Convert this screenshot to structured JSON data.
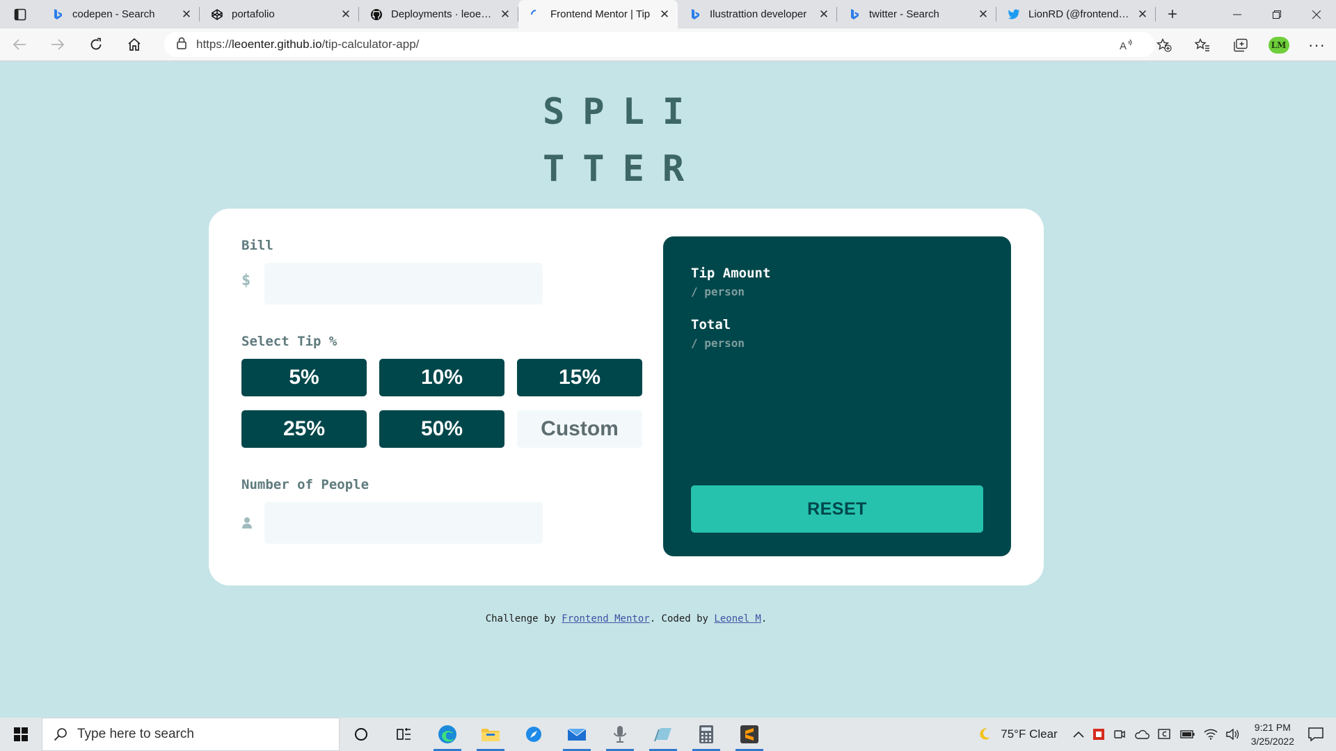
{
  "browser": {
    "tabs": [
      {
        "title": "codepen - Search",
        "icon": "bing-icon",
        "active": false
      },
      {
        "title": "portafolio",
        "icon": "codepen-icon",
        "active": false
      },
      {
        "title": "Deployments · leoenter",
        "icon": "github-icon",
        "active": false
      },
      {
        "title": "Frontend Mentor | Tip",
        "icon": "loading-icon",
        "active": true
      },
      {
        "title": "Ilustrattion developer",
        "icon": "bing-icon",
        "active": false
      },
      {
        "title": "twitter - Search",
        "icon": "bing-icon",
        "active": false
      },
      {
        "title": "LionRD (@frontendlion)",
        "icon": "twitter-icon",
        "active": false
      }
    ],
    "url_scheme": "https://",
    "url_host": "leoenter.github.io",
    "url_path": "/tip-calculator-app/",
    "profile_initials": "LM"
  },
  "app": {
    "logo_line1": "SPLI",
    "logo_line2": "TTER",
    "bill_label": "Bill",
    "bill_icon": "$",
    "bill_value": "",
    "tip_label": "Select Tip %",
    "tips": [
      "5%",
      "10%",
      "15%",
      "25%",
      "50%"
    ],
    "custom_placeholder": "Custom",
    "people_label": "Number of People",
    "people_value": "",
    "tip_amount_label": "Tip Amount",
    "tip_amount_sub": "/ person",
    "total_label": "Total",
    "total_sub": "/ person",
    "reset_label": "RESET",
    "colors": {
      "page_bg": "#c5e4e7",
      "dark_cyan": "#00474b",
      "strong_cyan": "#26c2ad",
      "input_bg": "#f3f9fa"
    }
  },
  "attribution": {
    "prefix": "Challenge by ",
    "link1": "Frontend Mentor",
    "middle": ". Coded by ",
    "link2": "Leonel M",
    "suffix": "."
  },
  "taskbar": {
    "search_placeholder": "Type here to search",
    "weather": "75°F  Clear",
    "time": "9:21 PM",
    "date": "3/25/2022"
  }
}
